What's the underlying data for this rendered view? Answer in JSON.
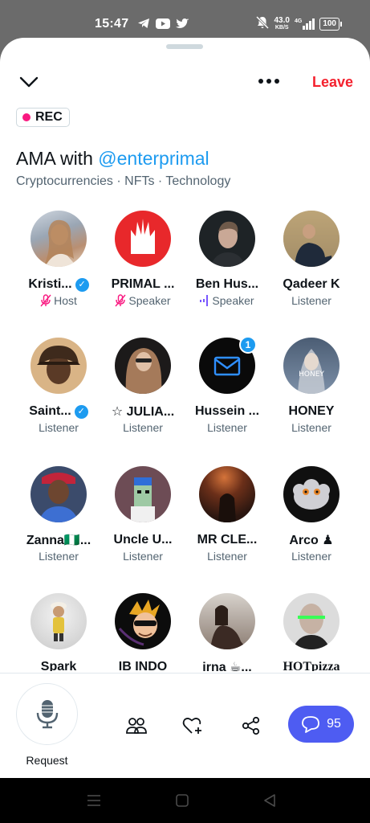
{
  "status_bar": {
    "time": "15:47",
    "net_speed": "43.0",
    "net_unit": "KB/S",
    "network": "4G",
    "battery": "100"
  },
  "header": {
    "leave_label": "Leave",
    "rec_label": "REC"
  },
  "space": {
    "title_prefix": "AMA with ",
    "title_handle": "@enterprimal",
    "topics": "Cryptocurrencies · NFTs · Technology"
  },
  "participants": [
    {
      "name": "Kristi...",
      "role": "Host",
      "verified": true,
      "mic": "muted"
    },
    {
      "name": "PRIMAL ...",
      "role": "Speaker",
      "mic": "muted"
    },
    {
      "name": "Ben Hus...",
      "role": "Speaker",
      "mic": "speaking"
    },
    {
      "name": "Qadeer K",
      "role": "Listener"
    },
    {
      "name": "Saint...",
      "role": "Listener",
      "verified": true
    },
    {
      "name": "☆ JULIA...",
      "role": "Listener"
    },
    {
      "name": "Hussein ...",
      "role": "Listener",
      "badge": "1"
    },
    {
      "name": "HONEY",
      "role": "Listener"
    },
    {
      "name": "Zanna🇳🇬...",
      "role": "Listener"
    },
    {
      "name": "Uncle U...",
      "role": "Listener"
    },
    {
      "name": "MR CLE...",
      "role": "Listener"
    },
    {
      "name": "Arco ♟",
      "role": "Listener"
    },
    {
      "name": "Spark",
      "role": ""
    },
    {
      "name": "IB INDO",
      "role": ""
    },
    {
      "name": "irna ☕...",
      "role": ""
    },
    {
      "name": "HOTpizza",
      "role": ""
    }
  ],
  "bottom_bar": {
    "request_label": "Request",
    "comment_count": "95"
  },
  "colors": {
    "accent": "#1d9bf0",
    "leave": "#f4212e",
    "rec": "#f91880",
    "comment_button": "#4e5cf2",
    "speaking": "#7856ff"
  }
}
